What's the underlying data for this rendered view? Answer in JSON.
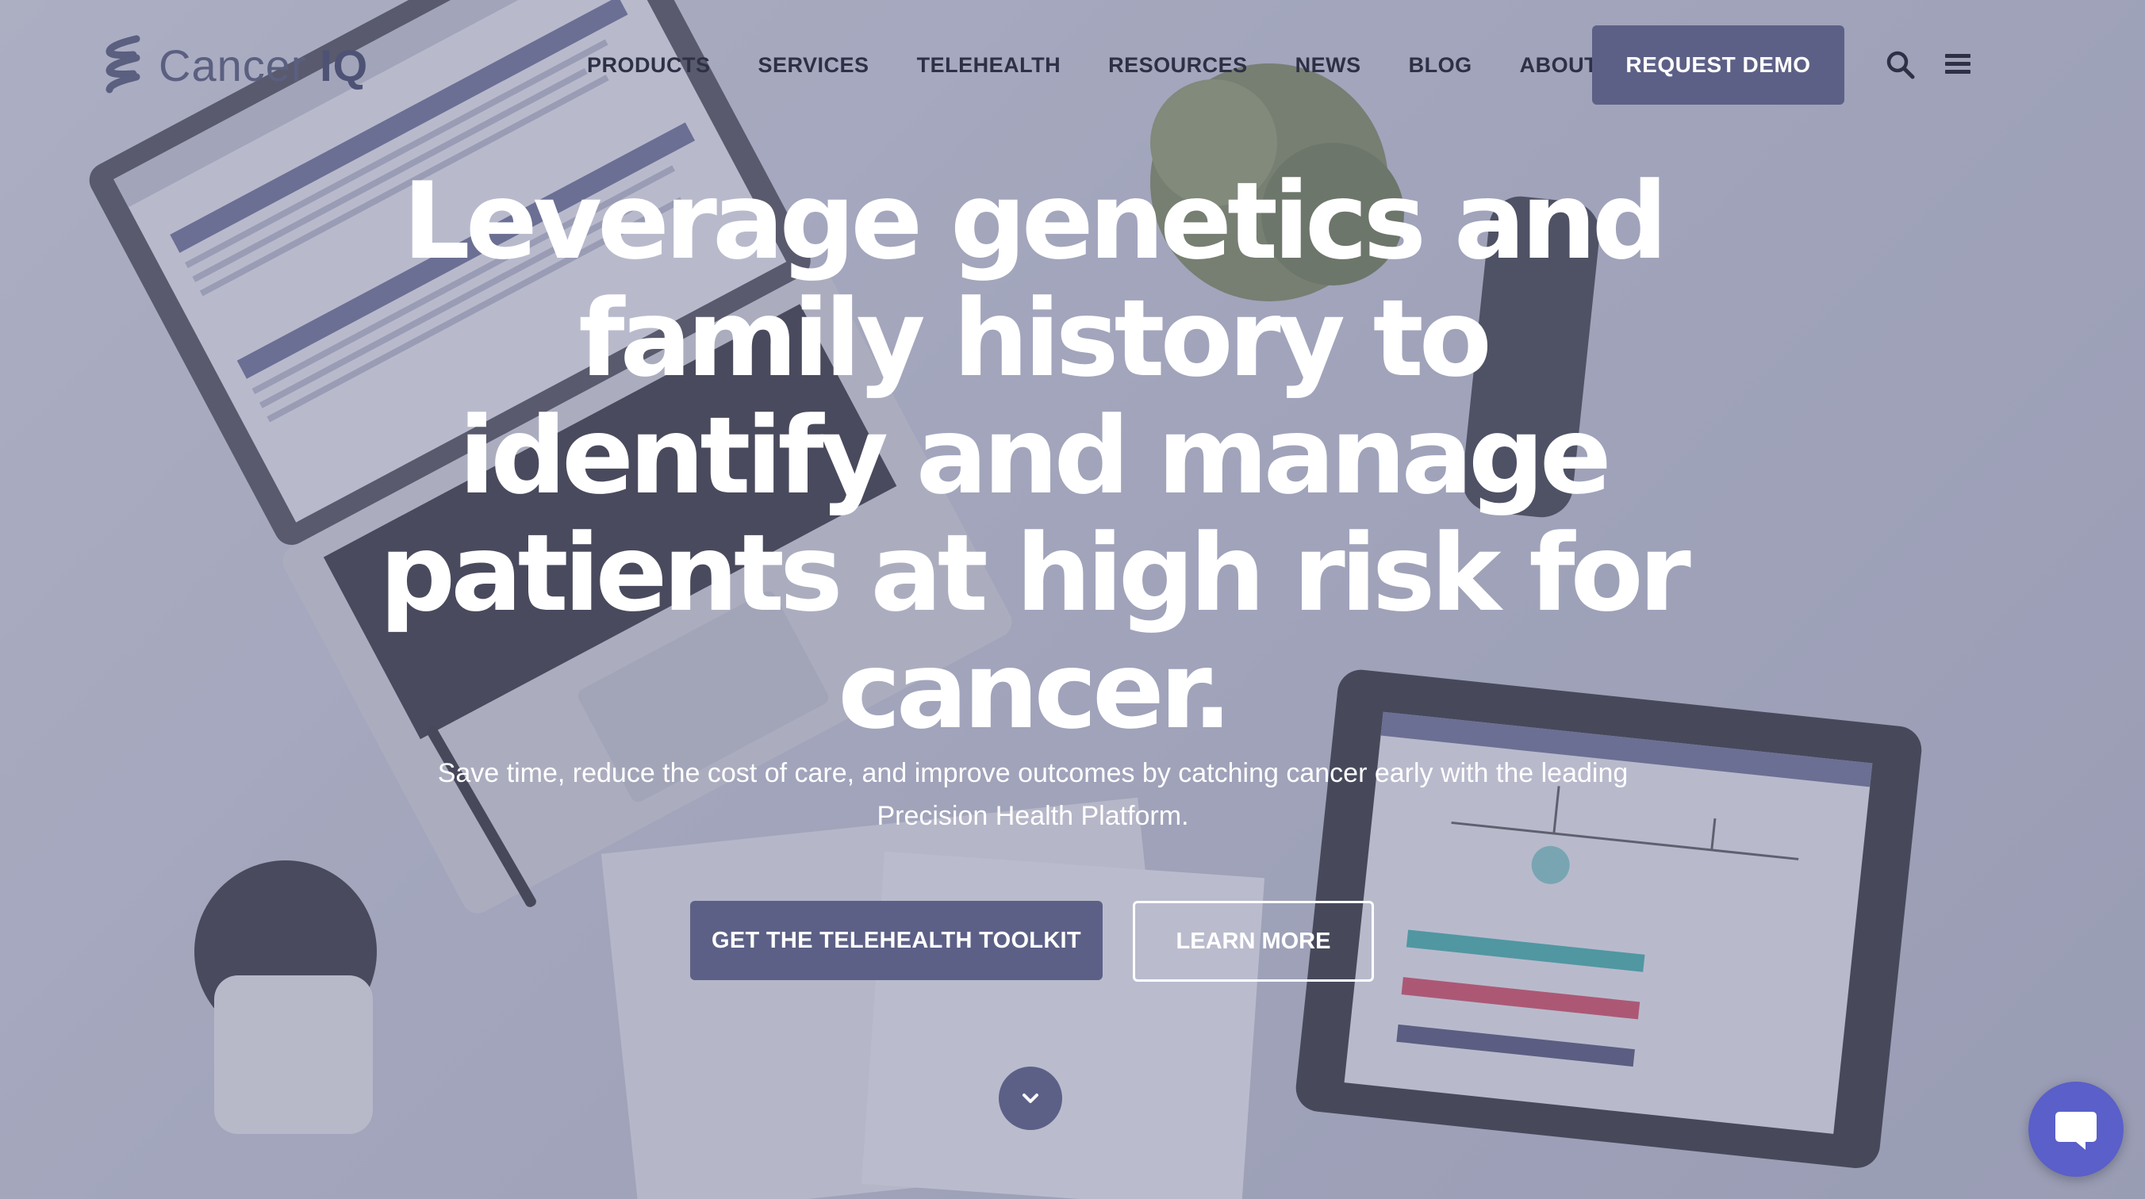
{
  "brand": {
    "name_part1": "Cancer",
    "name_part2": "IQ"
  },
  "nav": {
    "items": [
      {
        "label": "PRODUCTS"
      },
      {
        "label": "SERVICES"
      },
      {
        "label": "TELEHEALTH"
      },
      {
        "label": "RESOURCES"
      },
      {
        "label": "NEWS"
      },
      {
        "label": "BLOG"
      },
      {
        "label": "ABOUT US"
      }
    ],
    "cta_label": "REQUEST DEMO",
    "search_icon": "search-icon",
    "menu_icon": "hamburger-menu-icon"
  },
  "hero": {
    "headline_lines": [
      "Leverage genetics and",
      "family history to",
      "identify and manage",
      "patients at high risk for",
      "cancer."
    ],
    "subtext_line1": "Save time, reduce the cost of care, and improve outcomes by catching cancer early with the leading",
    "subtext_line2": "Precision Health Platform.",
    "primary_button": "GET THE TELEHEALTH TOOLKIT",
    "secondary_button": "LEARN MORE",
    "scroll_icon": "chevron-down-icon"
  },
  "chat": {
    "icon": "chat-bubble-icon"
  },
  "colors": {
    "accent": "#5d6086",
    "overlay": "#6e7194",
    "chat": "#5a5fc9",
    "text_light": "#ffffff",
    "nav_text": "#2e3045"
  }
}
